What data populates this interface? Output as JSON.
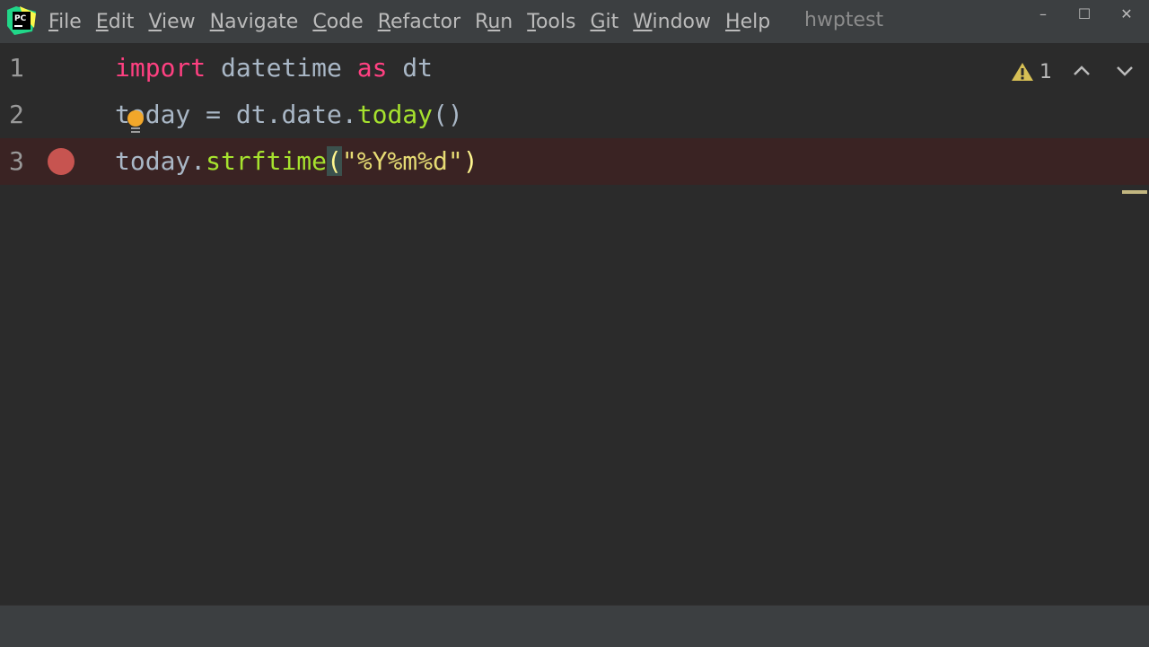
{
  "menubar": {
    "items": [
      {
        "mnemonic": "F",
        "rest": "ile"
      },
      {
        "mnemonic": "E",
        "rest": "dit"
      },
      {
        "mnemonic": "V",
        "rest": "iew"
      },
      {
        "mnemonic": "N",
        "rest": "avigate"
      },
      {
        "mnemonic": "C",
        "rest": "ode"
      },
      {
        "mnemonic": "R",
        "rest": "efactor"
      },
      {
        "pre": "R",
        "mnemonic": "u",
        "rest": "n"
      },
      {
        "mnemonic": "T",
        "rest": "ools"
      },
      {
        "mnemonic": "G",
        "rest": "it"
      },
      {
        "mnemonic": "W",
        "rest": "indow"
      },
      {
        "mnemonic": "H",
        "rest": "elp"
      }
    ],
    "project_title": "hwptest"
  },
  "window_controls": {
    "minimize": "–",
    "maximize": "☐",
    "close": "✕"
  },
  "editor": {
    "lines": [
      {
        "number": "1",
        "kw_import": "import",
        "module": " datetime ",
        "kw_as": "as",
        "alias": " dt"
      },
      {
        "number": "2",
        "t": "t",
        "oday": "oday",
        "assign": " = dt.date.",
        "call": "today",
        "parens": "()"
      },
      {
        "number": "3",
        "obj": "today.",
        "call": "strftime",
        "open_paren": "(",
        "arg": "\"%Y%m%d\"",
        "close_paren": ")"
      }
    ],
    "warnings_count": "1"
  },
  "colors": {
    "keyword": "#ff4081",
    "function": "#a6e22e",
    "string": "#e6db74",
    "breakpoint": "#c75450",
    "breakpoint_line_bg": "#3a2323"
  },
  "icons": [
    "pycharm-logo",
    "lightbulb-icon",
    "breakpoint-icon",
    "warning-icon",
    "chevron-up-icon",
    "chevron-down-icon"
  ]
}
